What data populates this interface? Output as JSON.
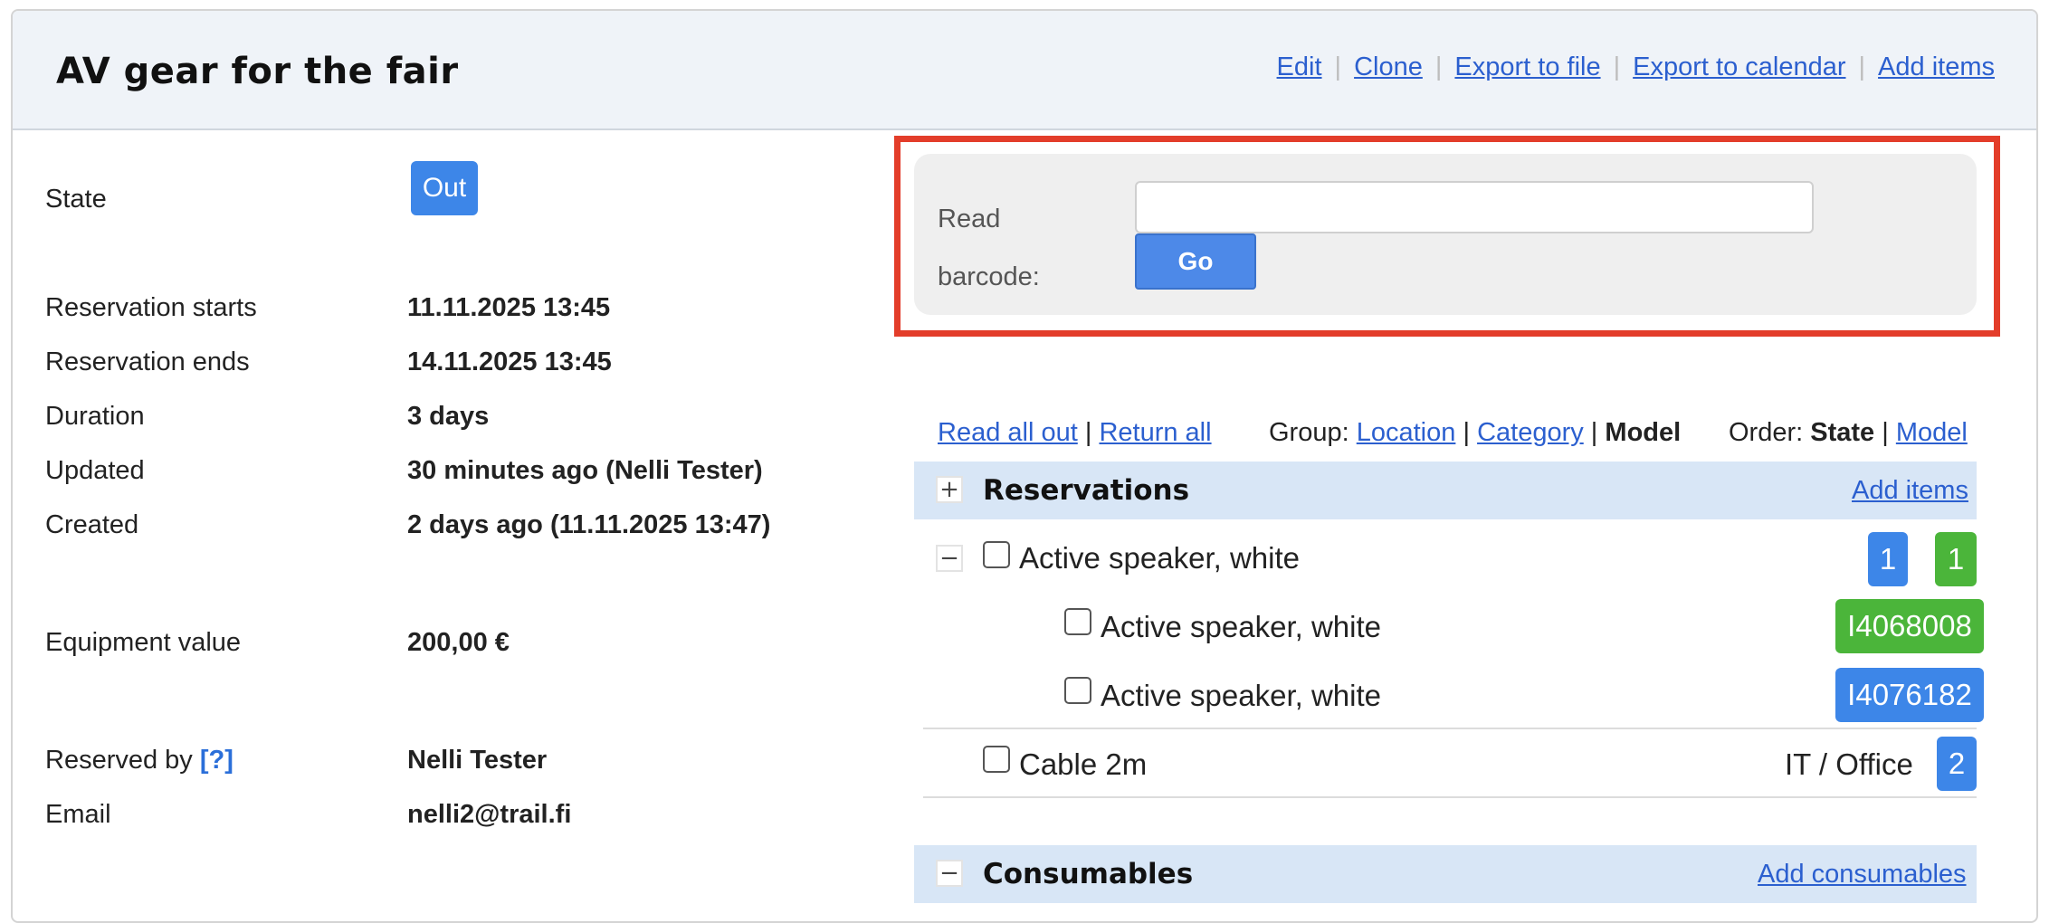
{
  "header": {
    "title": "AV gear for the fair",
    "links": [
      "Edit",
      "Clone",
      "Export to file",
      "Export to calendar",
      "Add items"
    ]
  },
  "details": {
    "state_label": "State",
    "state_value": "Out",
    "rows": [
      {
        "label": "Reservation starts",
        "value": "11.11.2025 13:45"
      },
      {
        "label": "Reservation ends",
        "value": "14.11.2025 13:45"
      },
      {
        "label": "Duration",
        "value": "3 days"
      },
      {
        "label": "Updated",
        "value": "30 minutes ago (Nelli Tester)"
      },
      {
        "label": "Created",
        "value": "2 days ago (11.11.2025 13:47)"
      },
      {
        "label": "Equipment value",
        "value": "200,00 €"
      }
    ],
    "reserved_by_label": "Reserved by",
    "reserved_by_help": "[?]",
    "reserved_by_value": "Nelli Tester",
    "email_label": "Email",
    "email_value": "nelli2@trail.fi"
  },
  "barcode": {
    "label_line1": "Read",
    "label_line2": "barcode:",
    "input_value": "",
    "go_label": "Go"
  },
  "toolbar": {
    "read_all_out": "Read all out",
    "return_all": "Return all",
    "group_label": "Group:",
    "group_location": "Location",
    "group_category": "Category",
    "group_model": "Model",
    "order_label": "Order:",
    "order_state": "State",
    "order_model": "Model",
    "sep": "|"
  },
  "reservations": {
    "toggle": "+",
    "title": "Reservations",
    "add_link": "Add items",
    "items": [
      {
        "toggle": "−",
        "name": "Active speaker, white",
        "badges": [
          "1",
          "1"
        ]
      },
      {
        "name": "Active speaker, white",
        "code": "I4068008"
      },
      {
        "name": "Active speaker, white",
        "code": "I4076182"
      },
      {
        "name": "Cable 2m",
        "location": "IT / Office",
        "count": "2"
      }
    ]
  },
  "consumables": {
    "toggle": "−",
    "title": "Consumables",
    "add_link": "Add consumables"
  },
  "colors": {
    "accent_blue": "#3d86e8",
    "status_green": "#4bb53a",
    "highlight_red": "#e33d2a",
    "link": "#2b5fcf"
  }
}
